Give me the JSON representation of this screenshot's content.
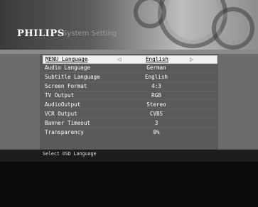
{
  "header": {
    "brand": "PHILIPS",
    "title": "System Setting"
  },
  "menu": {
    "items": [
      {
        "label": "MENU Language",
        "value": "English",
        "selected": true
      },
      {
        "label": "Audio Language",
        "value": "German"
      },
      {
        "label": "Subtitle Language",
        "value": "English"
      },
      {
        "label": "Screen Format",
        "value": "4:3"
      },
      {
        "label": "TV Output",
        "value": "RGB"
      },
      {
        "label": "AudioOutput",
        "value": "Stereo"
      },
      {
        "label": "VCR Output",
        "value": "CVBS"
      },
      {
        "label": "Banner Timeout",
        "value": "3"
      },
      {
        "label": "Transparency",
        "value": "0%"
      }
    ],
    "arrows": {
      "left": "◁",
      "right": "▷"
    }
  },
  "status": {
    "text": "Select OSD Language"
  }
}
